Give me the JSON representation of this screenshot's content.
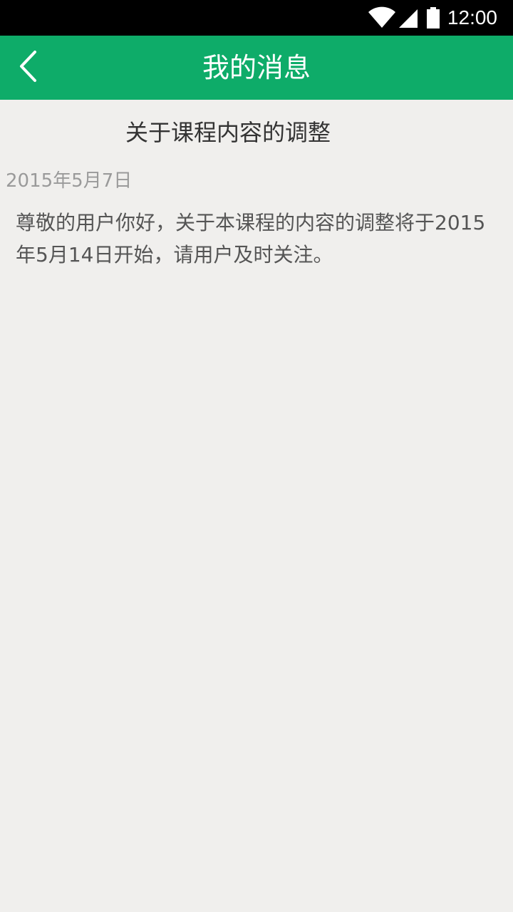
{
  "status_bar": {
    "time": "12:00",
    "icons": [
      "wifi-icon",
      "signal-icon",
      "battery-icon"
    ]
  },
  "app_bar": {
    "title": "我的消息",
    "back_icon": "chevron-left-icon",
    "color": "#0eac69"
  },
  "message": {
    "title": "关于课程内容的调整",
    "date": "2015年5月7日",
    "body": "尊敬的用户你好，关于本课程的内容的调整将于2015年5月14日开始，请用户及时关注。"
  },
  "colors": {
    "background": "#f0efed",
    "accent": "#0eac69"
  }
}
